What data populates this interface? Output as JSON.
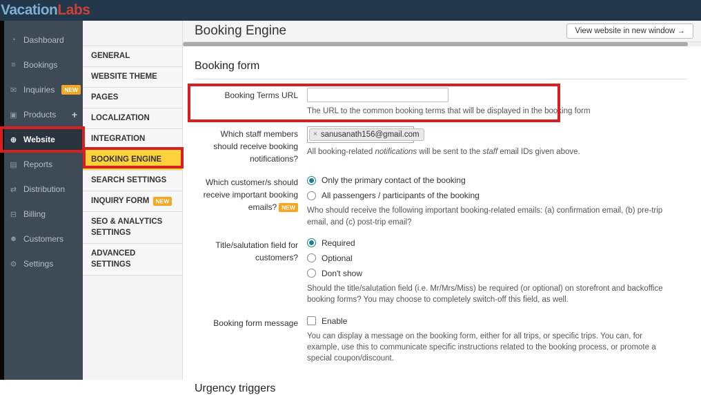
{
  "topbar": {
    "logo": {
      "part1": "Vacation",
      "part2": "Labs"
    }
  },
  "sidebar": {
    "items": [
      {
        "label": "Dashboard",
        "glyph": "◔"
      },
      {
        "label": "Bookings",
        "glyph": "≡"
      },
      {
        "label": "Inquiries",
        "glyph": "✉",
        "badge": "NEW"
      },
      {
        "label": "Products",
        "glyph": "▣",
        "suffix": "+"
      },
      {
        "label": "Website",
        "glyph": "⊕"
      },
      {
        "label": "Reports",
        "glyph": "▤"
      },
      {
        "label": "Distribution",
        "glyph": "⇄"
      },
      {
        "label": "Billing",
        "glyph": "⊟"
      },
      {
        "label": "Customers",
        "glyph": "☻"
      },
      {
        "label": "Settings",
        "glyph": "⚙"
      }
    ]
  },
  "secondary_nav": {
    "items": [
      {
        "label": "GENERAL"
      },
      {
        "label": "WEBSITE THEME"
      },
      {
        "label": "PAGES"
      },
      {
        "label": "LOCALIZATION"
      },
      {
        "label": "INTEGRATION"
      },
      {
        "label": "BOOKING ENGINE"
      },
      {
        "label": "SEARCH SETTINGS"
      },
      {
        "label": "INQUIRY FORM",
        "badge": "NEW"
      },
      {
        "label": "SEO & ANALYTICS SETTINGS"
      },
      {
        "label": "ADVANCED SETTINGS"
      }
    ]
  },
  "header": {
    "title": "Booking Engine",
    "view_website_button": "View website in new window →"
  },
  "booking_form": {
    "section_title": "Booking form",
    "terms": {
      "label": "Booking Terms URL",
      "input_value": "",
      "help": "The URL to the common booking terms that will be displayed in the booking form"
    },
    "staff": {
      "label": "Which staff members should receive booking notifications?",
      "email_chip": "sanusanath156@gmail.com",
      "remove_icon": "×",
      "help_parts": [
        "All booking-related ",
        "notifications",
        " will be sent to the ",
        "staff",
        " email IDs given above."
      ]
    },
    "customer_emails": {
      "label": "Which customer/s should receive important booking emails?",
      "badge": "NEW",
      "options": [
        "Only the primary contact of the booking",
        "All passengers / participants of the booking"
      ],
      "selected_index": 0,
      "help": "Who should receive the following important booking-related emails: (a) confirmation email, (b) pre-trip email, and (c) post-trip email?"
    },
    "salutation": {
      "label": "Title/salutation field for customers?",
      "options": [
        "Required",
        "Optional",
        "Don't show"
      ],
      "selected_index": 0,
      "help": "Should the title/salutation field (i.e. Mr/Mrs/Miss) be required (or optional) on storefront and backoffice booking forms? You may choose to completely switch-off this field, as well."
    },
    "message": {
      "label": "Booking form message",
      "checkbox_label": "Enable",
      "checked": false,
      "help": "You can display a message on the booking form, either for all trips, or specific trips. You can, for example, use this to communicate specific instructions related to the booking process, or promote a special coupon/discount."
    }
  },
  "next_section_title": "Urgency triggers",
  "colors": {
    "topbar_bg": "#22384a",
    "sidebar_bg": "#3e4a56",
    "logo_blue": "#7fafd2",
    "logo_red": "#cc4038",
    "badge_orange": "#f5a623",
    "active_menu_yellow": "#fdd23a",
    "radio_teal": "#1f7e93",
    "annotation_red": "#d81e1e"
  }
}
